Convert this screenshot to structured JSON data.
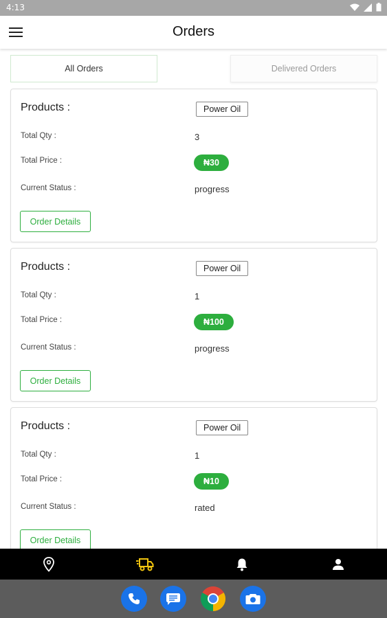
{
  "status_bar": {
    "time": "4:13"
  },
  "app_bar": {
    "title": "Orders",
    "menu_icon": "hamburger-menu-icon"
  },
  "tabs": [
    {
      "label": "All Orders",
      "active": true
    },
    {
      "label": "Delivered Orders",
      "active": false
    }
  ],
  "labels": {
    "products": "Products :",
    "total_qty": "Total Qty :",
    "total_price": "Total Price :",
    "current_status": "Current Status :",
    "order_details": "Order Details"
  },
  "orders": [
    {
      "product": "Power Oil",
      "qty": "3",
      "price": "₦30",
      "status": "progress"
    },
    {
      "product": "Power Oil",
      "qty": "1",
      "price": "₦100",
      "status": "progress"
    },
    {
      "product": "Power Oil",
      "qty": "1",
      "price": "₦10",
      "status": "rated"
    }
  ],
  "bottom_nav": [
    {
      "icon": "location-pin-icon",
      "active": false
    },
    {
      "icon": "delivery-truck-icon",
      "active": true
    },
    {
      "icon": "bell-icon",
      "active": false
    },
    {
      "icon": "person-icon",
      "active": false
    }
  ],
  "dock": [
    {
      "icon": "phone-icon"
    },
    {
      "icon": "messages-icon"
    },
    {
      "icon": "chrome-icon"
    },
    {
      "icon": "camera-icon"
    }
  ],
  "colors": {
    "accent_green": "#2dae3e",
    "active_nav": "#f1c40f",
    "dock_blue": "#1a73e8"
  }
}
